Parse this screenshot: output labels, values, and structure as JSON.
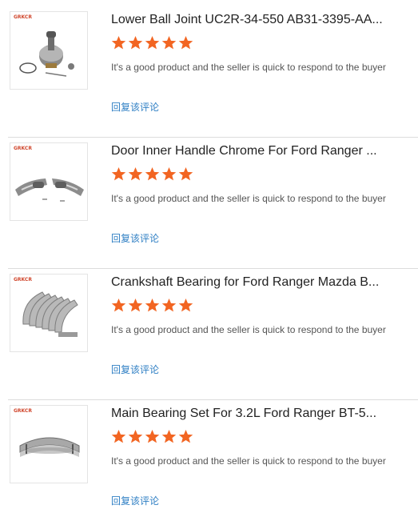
{
  "reviews": [
    {
      "brand": "GRKCR",
      "title": "Lower Ball Joint UC2R-34-550 AB31-3395-AA...",
      "rating": 5,
      "comment": "It's a good product and the seller is quick to respond to the buyer",
      "reply_label": "回复该评论",
      "image_icon": "ball-joint-image"
    },
    {
      "brand": "GRKCR",
      "title": "Door Inner Handle Chrome For Ford Ranger ...",
      "rating": 5,
      "comment": "It's a good product and the seller is quick to respond to the buyer",
      "reply_label": "回复该评论",
      "image_icon": "door-handle-image"
    },
    {
      "brand": "GRKCR",
      "title": "Crankshaft Bearing for Ford Ranger Mazda B...",
      "rating": 5,
      "comment": "It's a good product and the seller is quick to respond to the buyer",
      "reply_label": "回复该评论",
      "image_icon": "crankshaft-bearing-image"
    },
    {
      "brand": "GRKCR",
      "title": "Main Bearing Set For 3.2L Ford Ranger BT-5...",
      "rating": 5,
      "comment": "It's a good product and the seller is quick to respond to the buyer",
      "reply_label": "回复该评论",
      "image_icon": "main-bearing-image"
    }
  ],
  "colors": {
    "star": "#f26522",
    "reply_link": "#2f7fc4",
    "divider": "#dcdcdc"
  }
}
